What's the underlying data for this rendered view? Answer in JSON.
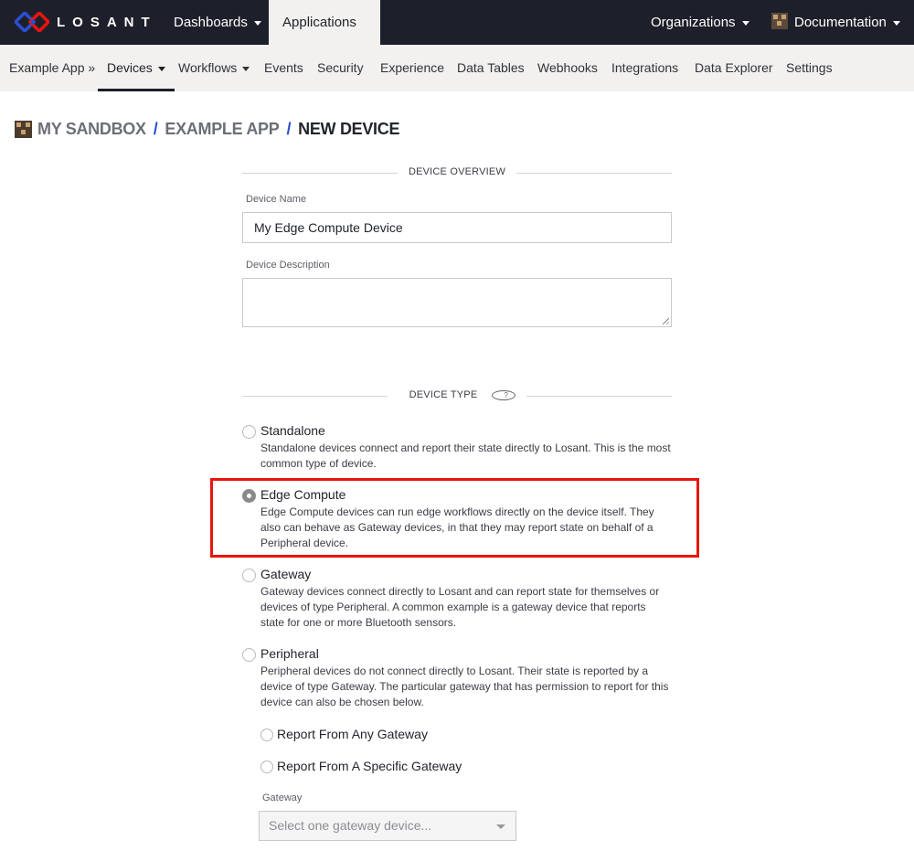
{
  "topnav": {
    "logo_text": "LOSANT",
    "dashboards": "Dashboards",
    "applications": "Applications",
    "organizations": "Organizations",
    "documentation": "Documentation"
  },
  "subnav": {
    "items": [
      "Example App »",
      "Devices",
      "Workflows",
      "Events",
      "Security",
      "Experience",
      "Data Tables",
      "Webhooks",
      "Integrations",
      "Data Explorer",
      "Settings"
    ],
    "active": "Devices"
  },
  "breadcrumb": {
    "parts": [
      "MY SANDBOX",
      "EXAMPLE APP",
      "NEW DEVICE"
    ],
    "separator": "/"
  },
  "form": {
    "overview_heading": "DEVICE OVERVIEW",
    "name_label": "Device Name",
    "name_value": "My Edge Compute Device",
    "description_label": "Device Description",
    "description_value": "",
    "type_heading": "DEVICE TYPE",
    "type_help_icon": "help-circle-icon",
    "types": [
      {
        "title": "Standalone",
        "desc": "Standalone devices connect and report their state directly to Losant. This is the most common type of device.",
        "checked": false
      },
      {
        "title": "Edge Compute",
        "desc": "Edge Compute devices can run edge workflows directly on the device itself. They also can behave as Gateway devices, in that they may report state on behalf of a Peripheral device.",
        "checked": true
      },
      {
        "title": "Gateway",
        "desc": "Gateway devices connect directly to Losant and can report state for themselves or devices of type Peripheral. A common example is a gateway device that reports state for one or more Bluetooth sensors.",
        "checked": false
      },
      {
        "title": "Peripheral",
        "desc": "Peripheral devices do not connect directly to Losant. Their state is reported by a device of type Gateway. The particular gateway that has permission to report for this device can also be chosen below.",
        "checked": false
      }
    ],
    "peripheral_options": [
      "Report From Any Gateway",
      "Report From A Specific Gateway"
    ],
    "gateway_label": "Gateway",
    "gateway_placeholder": "Select one gateway device..."
  },
  "colors": {
    "topnav_bg": "#1d202a",
    "subnav_bg": "#f2f1ef",
    "logo_blue": "#2b4fd3",
    "logo_red": "#e8150f",
    "highlight": "#e8150f"
  }
}
